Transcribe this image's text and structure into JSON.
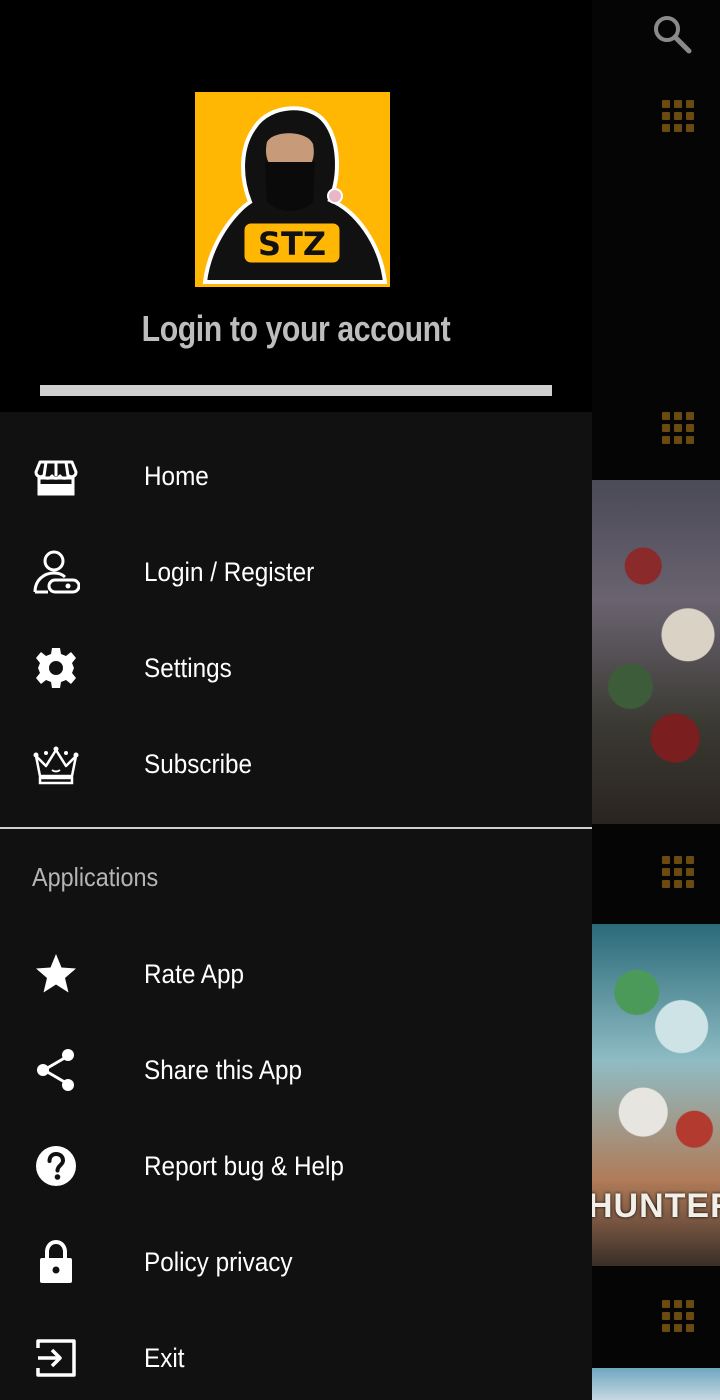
{
  "header": {
    "avatar_text": "STZ",
    "title": "Login to your account",
    "progress": 1.0
  },
  "menu": {
    "items": [
      {
        "label": "Home",
        "icon": "store-icon"
      },
      {
        "label": "Login / Register",
        "icon": "user-key-icon"
      },
      {
        "label": "Settings",
        "icon": "gear-icon"
      },
      {
        "label": "Subscribe",
        "icon": "crown-icon"
      }
    ]
  },
  "applications": {
    "section_label": "Applications",
    "items": [
      {
        "label": "Rate App",
        "icon": "star-icon"
      },
      {
        "label": "Share this App",
        "icon": "share-icon"
      },
      {
        "label": "Report bug & Help",
        "icon": "help-icon"
      },
      {
        "label": "Policy privacy",
        "icon": "lock-icon"
      },
      {
        "label": "Exit",
        "icon": "exit-icon"
      }
    ]
  },
  "background": {
    "poster_text": "HUNTER",
    "accent_color": "#6b4a10"
  },
  "colors": {
    "drawer_bg": "#111111",
    "header_bg": "#000000",
    "avatar_bg": "#ffb703",
    "text": "#ffffff",
    "muted_text": "#bdbdbd"
  }
}
